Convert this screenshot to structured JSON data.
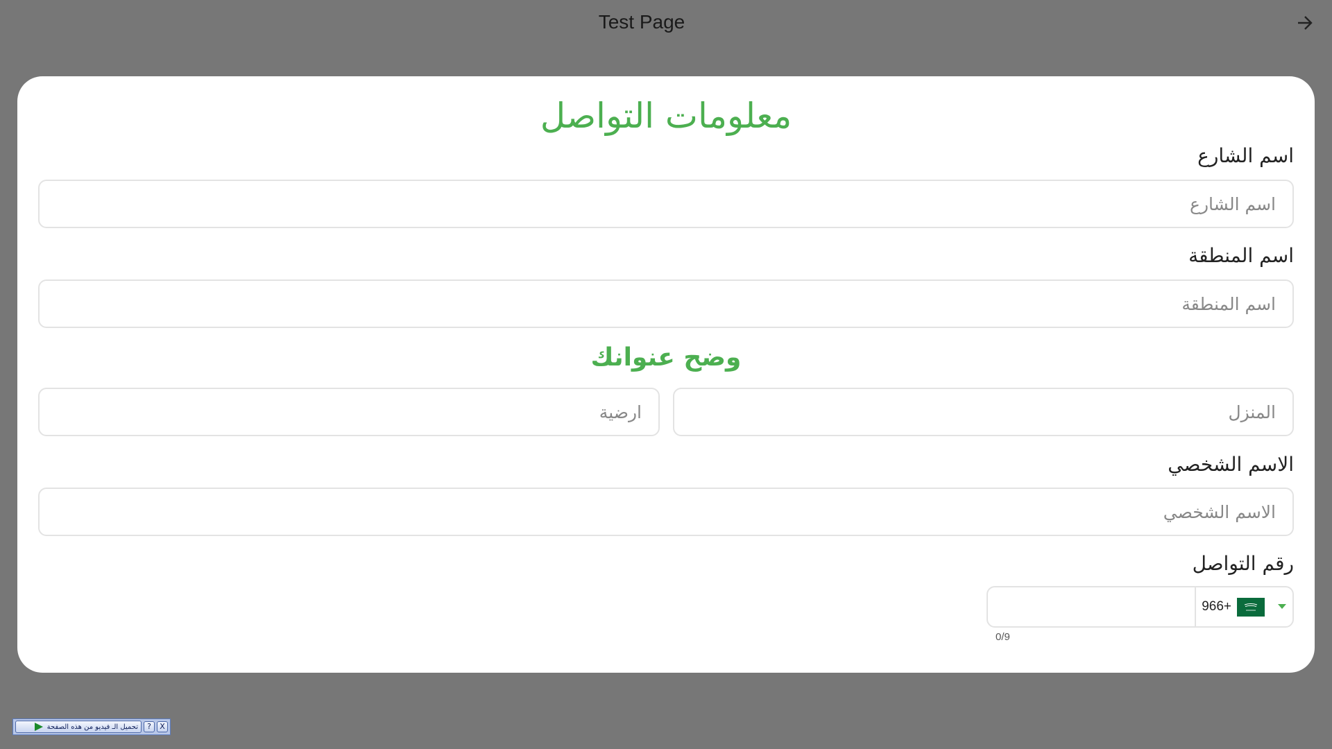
{
  "topbar": {
    "title": "Test Page",
    "forward_icon": "arrow-right-icon"
  },
  "form": {
    "heading": "معلومات التواصل",
    "street": {
      "label": "اسم الشارع",
      "placeholder": "اسم الشارع"
    },
    "district": {
      "label": "اسم المنطقة",
      "placeholder": "اسم المنطقة"
    },
    "address_heading": "وضح عنوانك",
    "house": {
      "placeholder": "المنزل"
    },
    "floor": {
      "placeholder": "ارضية"
    },
    "personal_name": {
      "label": "الاسم الشخصي",
      "placeholder": "الاسم الشخصي"
    },
    "phone": {
      "label": "رقم التواصل",
      "country_code": "966+",
      "flag_icon": "saudi-flag-icon",
      "counter": "0/9",
      "value": ""
    }
  },
  "video_toolbar": {
    "download_label": "تحميل الـ فيديو من هذه الصفحة",
    "help_label": "?",
    "close_label": "X"
  },
  "colors": {
    "accent": "#4caf50",
    "background": "#777777",
    "card": "#ffffff",
    "flag_green": "#0a6b3c"
  }
}
